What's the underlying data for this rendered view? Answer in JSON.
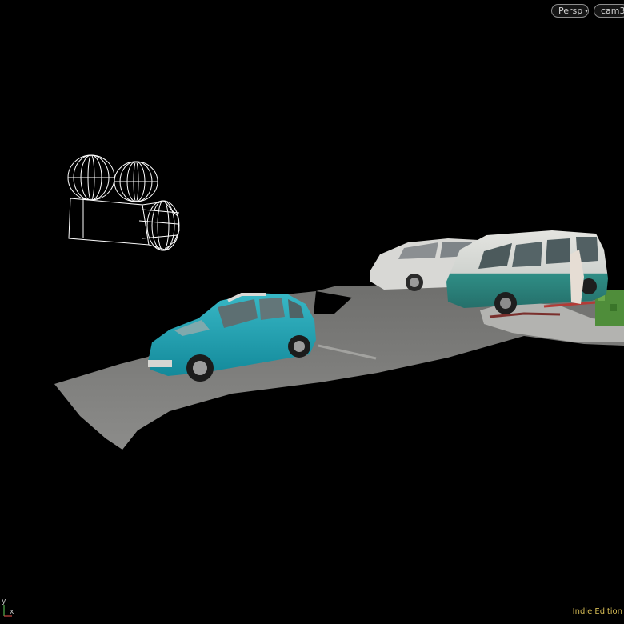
{
  "viewport": {
    "view_menu_label": "Persp",
    "camera_menu_label": "cam3",
    "axis_labels": {
      "y": "y",
      "x": "x"
    },
    "edition_label": "Indie Edition",
    "colors": {
      "background": "#000000",
      "ground": "#7d7d7b",
      "teal_car": "#1e9fb0",
      "camera_wireframe": "#ffffff",
      "edition_text": "#d6bc55"
    },
    "icons": {
      "dropdown_caret": "▾",
      "camera_object": "camera-wireframe-icon"
    }
  }
}
